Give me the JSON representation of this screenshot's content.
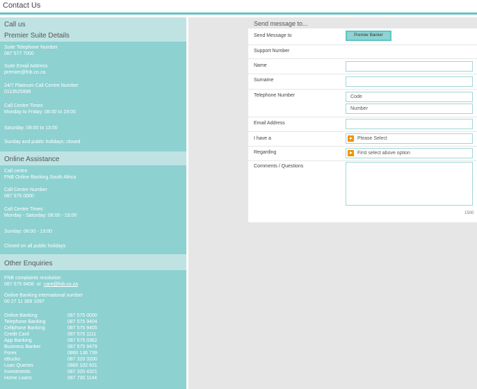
{
  "page": {
    "title": "Contact Us"
  },
  "left": {
    "call_us": "Call us",
    "premier": {
      "title": "Premier Suite Details",
      "items": [
        [
          "Suite Telephone Number",
          "087 577 7000"
        ],
        [
          "Suite Email Address",
          "premier@fnb.co.za"
        ],
        [
          "24/7 Platinum Call Centre Number",
          "0113525996"
        ],
        [
          "Call Centre Times",
          "Monday to Friday: 08:00 to 19:00"
        ],
        [
          "Saturday: 08:00 to 13:00"
        ],
        [
          "Sunday and public holidays: closed"
        ]
      ]
    },
    "online": {
      "title": "Online Assistance",
      "items": [
        [
          "Call centre",
          "FNB Online Banking South Africa"
        ],
        [
          "Call Centre Number",
          "087 575 0000"
        ],
        [
          "Call Centre Times",
          "Monday - Saturday: 08:00 - 19:00"
        ],
        [
          "Sunday: 08:00 - 13:00"
        ],
        [
          "Closed on all public holidays"
        ]
      ]
    },
    "other": {
      "title": "Other Enquiries",
      "complaints_label": "FNB complaints resolution",
      "complaints_number": "087 575 9408",
      "or": "or",
      "complaints_email": "care@fnb.co.za",
      "intl_label": "Online Banking international number",
      "intl_number": "00 27 11 369 1097",
      "table": [
        [
          "Online Banking",
          "087 575 0000"
        ],
        [
          "Telephone Banking",
          "087 575 9404"
        ],
        [
          "Cellphone Banking",
          "087 575 9405"
        ],
        [
          "Credit Card",
          "087 575 1111"
        ],
        [
          "App Banking",
          "087 575 0362"
        ],
        [
          "Business Banker",
          "087 575 9479"
        ],
        [
          "Forex",
          "0860 136 739"
        ],
        [
          "eBucks",
          "087 320 3200"
        ],
        [
          "Loan Queries",
          "0860 102 631"
        ],
        [
          "Investments",
          "087 320 4321"
        ],
        [
          "Home Loans",
          "087 730 1144"
        ]
      ]
    }
  },
  "form": {
    "heading": "Send message to...",
    "send_to_label": "Send Message to",
    "send_to_button": "Premier Banker",
    "support_number_label": "Support Number",
    "name_label": "Name",
    "surname_label": "Surname",
    "telephone_label": "Telephone Number",
    "code_placeholder": "Code",
    "number_placeholder": "Number",
    "email_label": "Email Address",
    "i_have_a_label": "I have a",
    "i_have_a_value": "Please Select",
    "regarding_label": "Regarding",
    "regarding_value": "First select above option",
    "comments_label": "Comments / Questions",
    "char_counter": "1500"
  }
}
